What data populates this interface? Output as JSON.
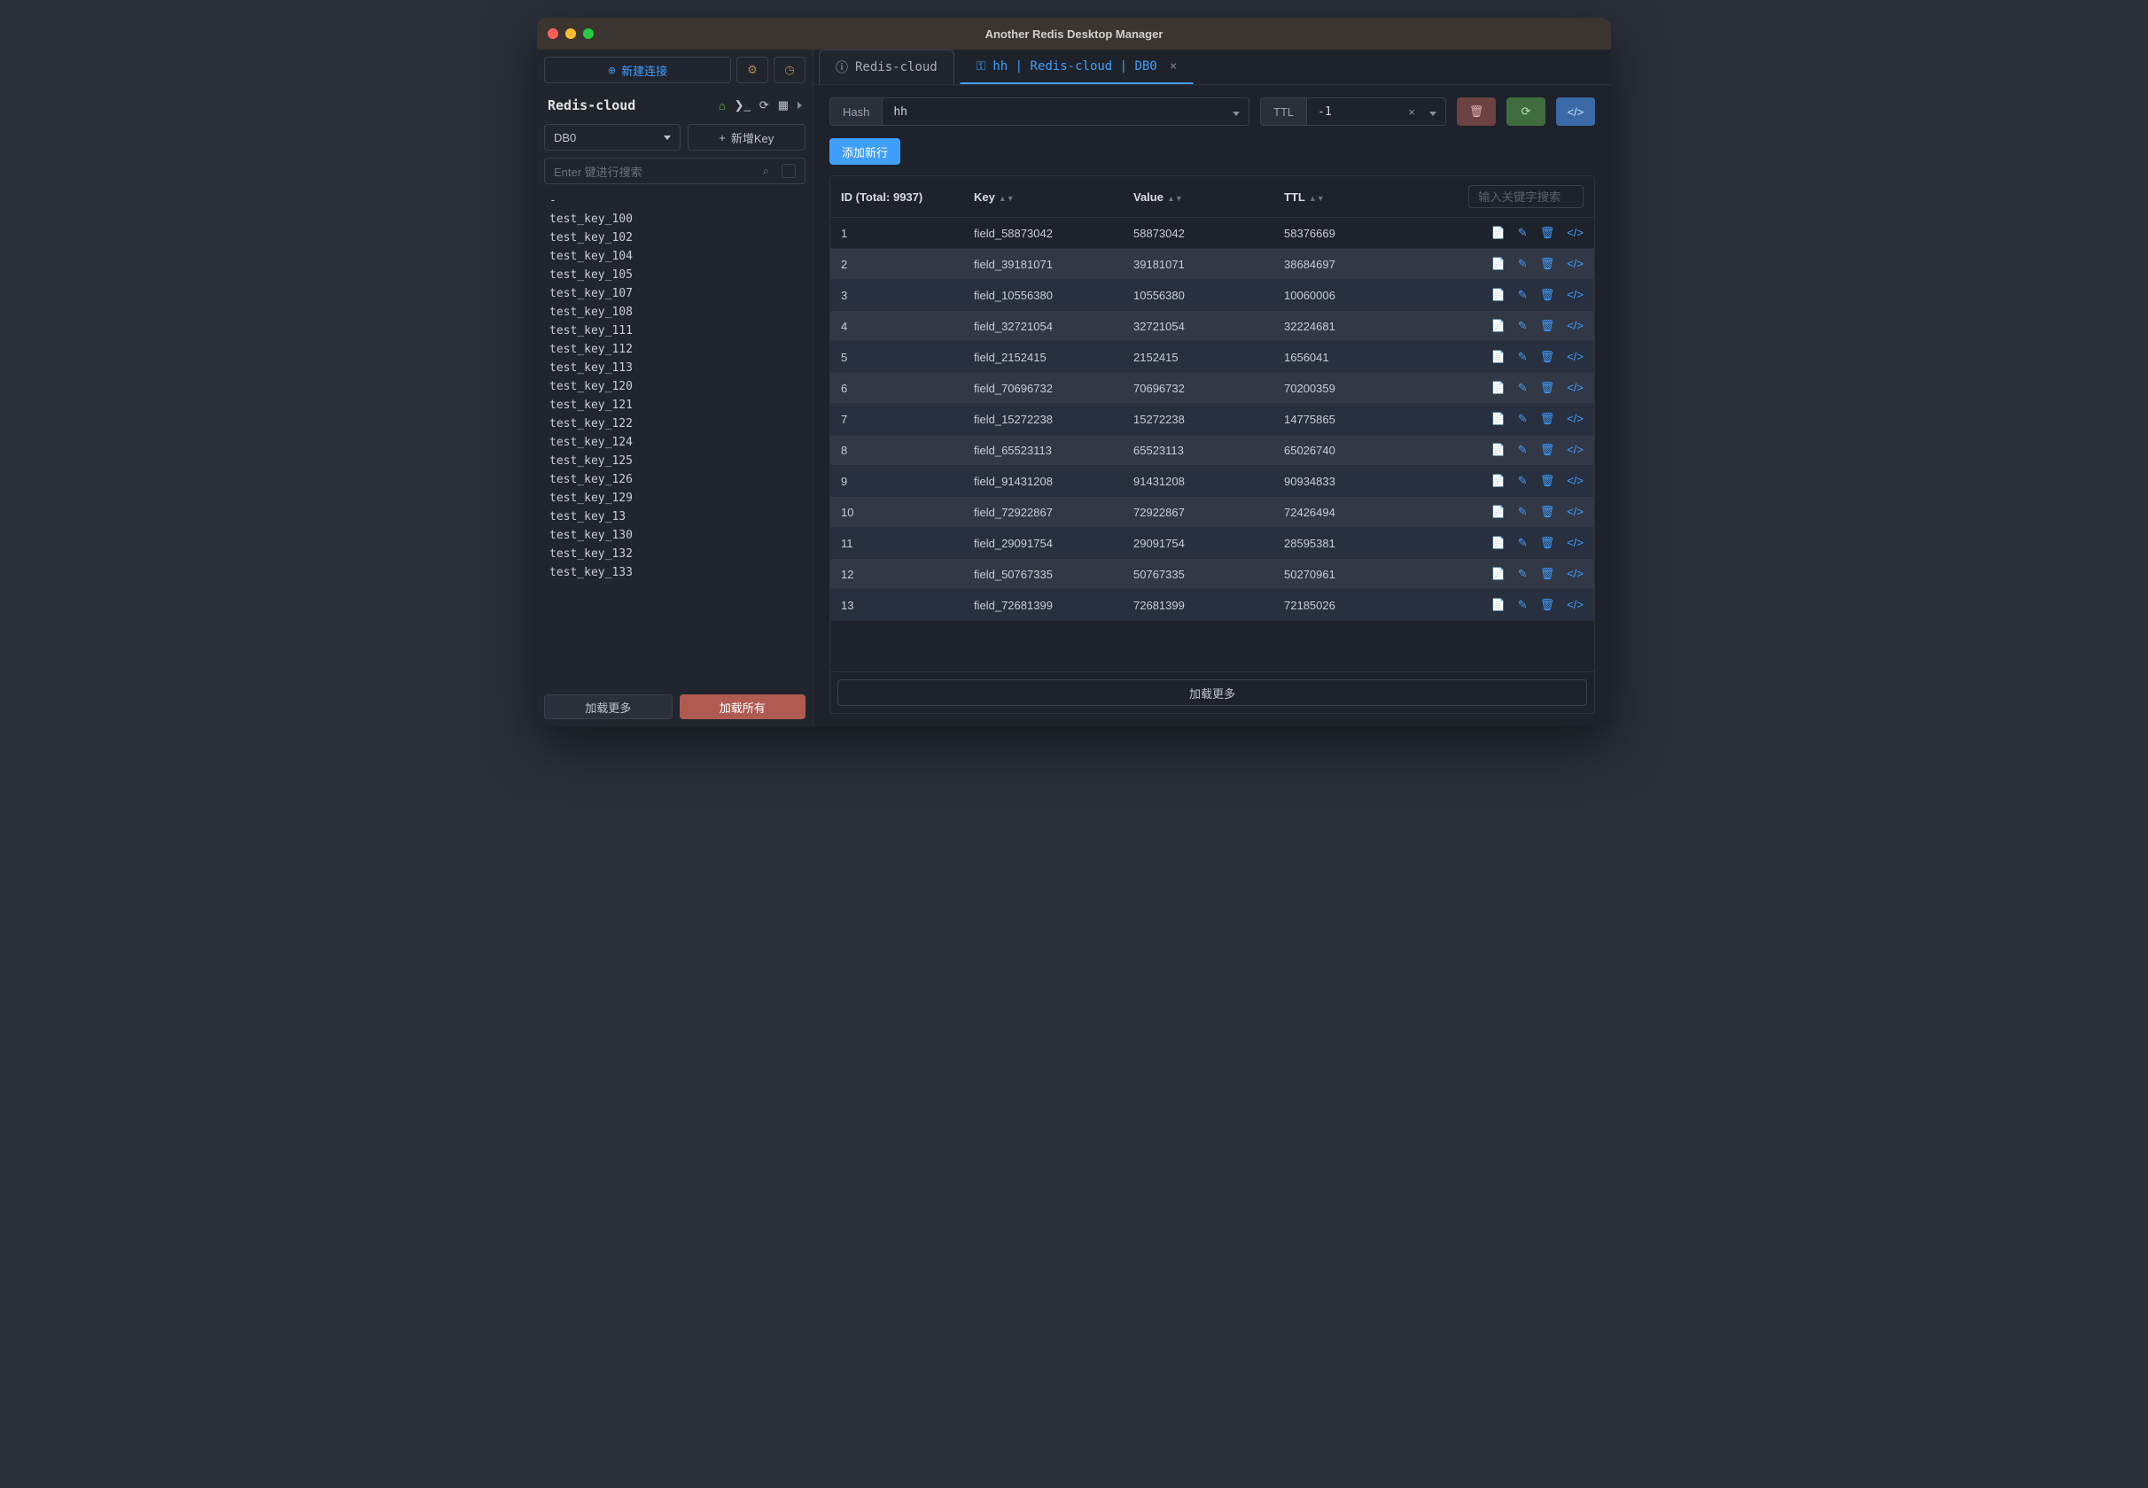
{
  "titlebar": {
    "title": "Another Redis Desktop Manager"
  },
  "sidebar": {
    "new_conn": "新建连接",
    "connection_name": "Redis-cloud",
    "db_select": "DB0",
    "new_key": "新增Key",
    "search_placeholder": "Enter 键进行搜索",
    "keys": [
      "-",
      "test_key_100",
      "test_key_102",
      "test_key_104",
      "test_key_105",
      "test_key_107",
      "test_key_108",
      "test_key_111",
      "test_key_112",
      "test_key_113",
      "test_key_120",
      "test_key_121",
      "test_key_122",
      "test_key_124",
      "test_key_125",
      "test_key_126",
      "test_key_129",
      "test_key_13",
      "test_key_130",
      "test_key_132",
      "test_key_133"
    ],
    "load_more": "加载更多",
    "load_all": "加载所有"
  },
  "tabs": [
    {
      "label": "Redis-cloud",
      "type": "info",
      "active": false
    },
    {
      "label": "hh | Redis-cloud | DB0",
      "type": "key",
      "active": true
    }
  ],
  "toolbar": {
    "type_label": "Hash",
    "key_name": "hh",
    "ttl_label": "TTL",
    "ttl_value": "-1"
  },
  "add_row": "添加新行",
  "table": {
    "id_header": "ID (Total: 9937)",
    "key_header": "Key",
    "value_header": "Value",
    "ttl_header": "TTL",
    "filter_placeholder": "输入关键字搜索",
    "rows": [
      {
        "id": "1",
        "key": "field_58873042",
        "value": "58873042",
        "ttl": "58376669"
      },
      {
        "id": "2",
        "key": "field_39181071",
        "value": "39181071",
        "ttl": "38684697"
      },
      {
        "id": "3",
        "key": "field_10556380",
        "value": "10556380",
        "ttl": "10060006"
      },
      {
        "id": "4",
        "key": "field_32721054",
        "value": "32721054",
        "ttl": "32224681"
      },
      {
        "id": "5",
        "key": "field_2152415",
        "value": "2152415",
        "ttl": "1656041"
      },
      {
        "id": "6",
        "key": "field_70696732",
        "value": "70696732",
        "ttl": "70200359"
      },
      {
        "id": "7",
        "key": "field_15272238",
        "value": "15272238",
        "ttl": "14775865"
      },
      {
        "id": "8",
        "key": "field_65523113",
        "value": "65523113",
        "ttl": "65026740"
      },
      {
        "id": "9",
        "key": "field_91431208",
        "value": "91431208",
        "ttl": "90934833"
      },
      {
        "id": "10",
        "key": "field_72922867",
        "value": "72922867",
        "ttl": "72426494"
      },
      {
        "id": "11",
        "key": "field_29091754",
        "value": "29091754",
        "ttl": "28595381"
      },
      {
        "id": "12",
        "key": "field_50767335",
        "value": "50767335",
        "ttl": "50270961"
      },
      {
        "id": "13",
        "key": "field_72681399",
        "value": "72681399",
        "ttl": "72185026"
      }
    ],
    "footer_load_more": "加载更多"
  }
}
